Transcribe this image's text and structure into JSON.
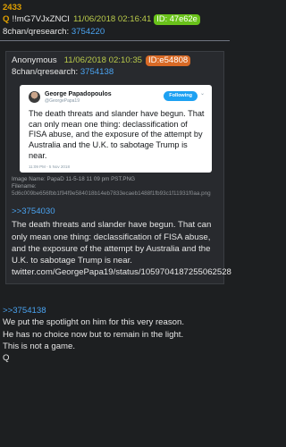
{
  "post": {
    "number": "2433",
    "author_icon": "Q",
    "tripcode": "!!mG7VJxZNCI",
    "datetime": "11/06/2018 02:16:41",
    "id_label": "ID: 47e62e",
    "board": "8chan/qresearch:",
    "post_link": "3754220"
  },
  "quoted": {
    "author": "Anonymous",
    "datetime": "11/06/2018 02:10:35",
    "id_label": "ID:e54808",
    "board": "8chan/qresearch:",
    "post_link": "3754138",
    "tweet": {
      "name": "George Papadopoulos",
      "handle": "@GeorgePapa19",
      "follow_label": "Following",
      "caret": "⌄",
      "text": "The death threats and slander have begun. That can only mean one thing: declassification of FISA abuse, and the exposure of the attempt by Australia and the U.K. to sabotage Trump is near.",
      "time": "11:09 PM - 5 Nov 2018"
    },
    "image_name": "Image Name: PapaD 11-5-18 11 09 pm PST.PNG",
    "filename_label": "Filename:",
    "filename": "5d6c009be656fbb1f94f9e584018b14eb7833ecaeb1488f1fb93c1f11931f0aa.png",
    "reply_ref": ">>3754030",
    "body": "The death threats and slander have begun. That can only mean one thing: declassification of FISA abuse, and the exposure of the attempt by Australia and the U.K. to sabotage Trump is near. twitter.com/GeorgePapa19/status/1059704187255062528"
  },
  "reply": {
    "ref": ">>3754138",
    "lines": [
      "We put the spotlight on him for this very reason.",
      "He has no choice now but to remain in the light.",
      "This is not a game.",
      "Q"
    ]
  }
}
